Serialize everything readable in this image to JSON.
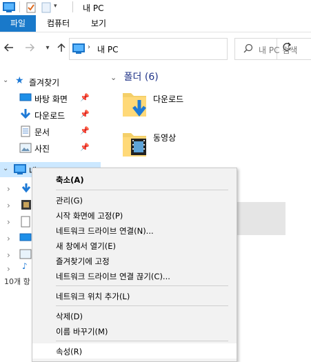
{
  "window": {
    "title": "내 PC"
  },
  "ribbon": {
    "tabs": [
      "파일",
      "컴퓨터",
      "보기"
    ]
  },
  "address": {
    "path": "내 PC",
    "search_placeholder": "내 PC 검색"
  },
  "nav": {
    "quick_access": "즐겨찾기",
    "items": [
      "바탕 화면",
      "다운로드",
      "문서",
      "사진"
    ],
    "this_pc": "내 PC"
  },
  "main": {
    "folders_header": "폴더 (6)",
    "folders": [
      "다운로드",
      "동영상"
    ]
  },
  "status": {
    "text": "10개 항"
  },
  "context_menu": {
    "items": [
      "축소(A)",
      "관리(G)",
      "시작 화면에 고정(P)",
      "네트워크 드라이브 연결(N)...",
      "새 창에서 열기(E)",
      "즐겨찾기에 고정",
      "네트워크 드라이브 연결 끊기(C)...",
      "네트워크 위치 추가(L)",
      "삭제(D)",
      "이름 바꾸기(M)",
      "속성(R)"
    ]
  },
  "colors": {
    "accent": "#1979ca",
    "selection": "#cce8ff",
    "menu_bg": "#f2f2f2",
    "folder_header": "#1e3287"
  },
  "icons": {
    "title": [
      "computer-icon",
      "properties-icon",
      "new-folder-icon",
      "customize-dropdown-icon"
    ],
    "nav": [
      "back-arrow-icon",
      "forward-arrow-icon",
      "recent-dropdown-icon",
      "up-arrow-icon",
      "refresh-icon",
      "search-icon"
    ],
    "tree": [
      "star-icon",
      "desktop-icon",
      "download-icon",
      "document-icon",
      "picture-icon",
      "pin-icon",
      "computer-icon"
    ]
  }
}
